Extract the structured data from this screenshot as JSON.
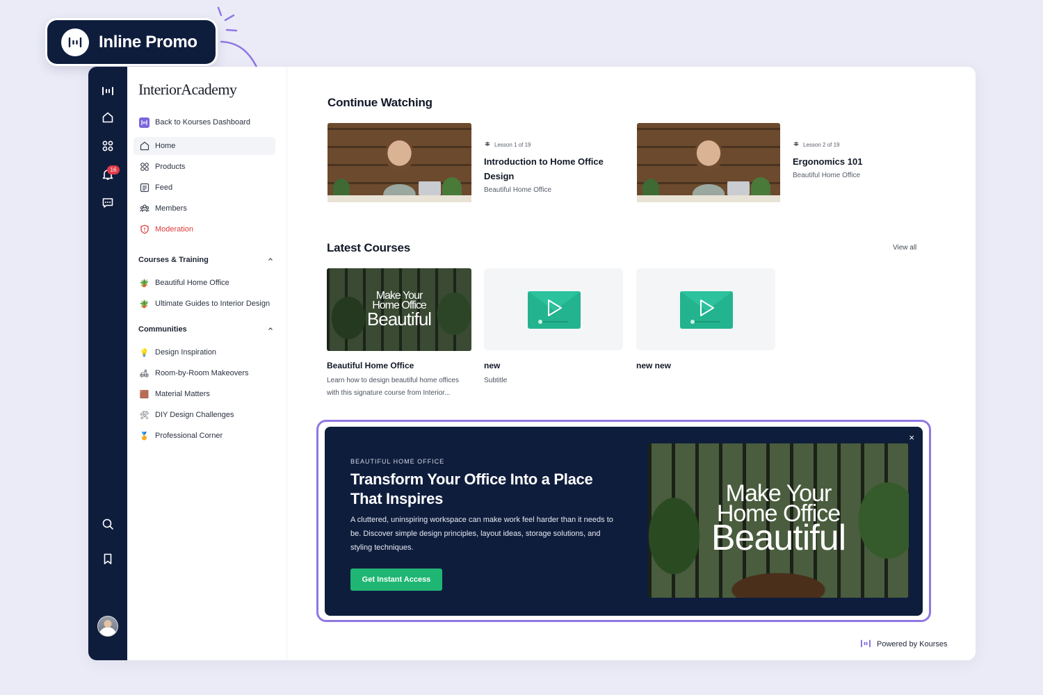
{
  "callout": {
    "label": "Inline Promo"
  },
  "rail": {
    "notification_count": "16"
  },
  "sidebar": {
    "brand": "InteriorAcademy",
    "back_link": "Back to Kourses Dashboard",
    "nav": [
      {
        "label": "Home",
        "icon": "home-icon"
      },
      {
        "label": "Products",
        "icon": "grid-icon"
      },
      {
        "label": "Feed",
        "icon": "feed-icon"
      },
      {
        "label": "Members",
        "icon": "members-icon"
      },
      {
        "label": "Moderation",
        "icon": "shield-icon"
      }
    ],
    "courses_heading": "Courses & Training",
    "courses": [
      {
        "label": "Beautiful Home Office",
        "emoji": "🪴"
      },
      {
        "label": "Ultimate Guides to Interior Design",
        "emoji": "🪴"
      }
    ],
    "communities_heading": "Communities",
    "communities": [
      {
        "label": "Design Inspiration",
        "emoji": "💡"
      },
      {
        "label": "Room-by-Room Makeovers",
        "emoji": "🛋"
      },
      {
        "label": "Material Matters",
        "emoji": "🟫"
      },
      {
        "label": "DIY Design Challenges",
        "emoji": "🛠"
      },
      {
        "label": "Professional Corner",
        "emoji": "🏅"
      }
    ]
  },
  "main": {
    "continue_heading": "Continue Watching",
    "continue": [
      {
        "lesson": "Lesson 1 of 19",
        "title": "Introduction to Home Office Design",
        "course": "Beautiful Home Office"
      },
      {
        "lesson": "Lesson 2 of 19",
        "title": "Ergonomics 101",
        "course": "Beautiful Home Office"
      }
    ],
    "latest_heading": "Latest Courses",
    "view_all": "View all",
    "thumb_text": {
      "line1": "Make Your",
      "line2": "Home Office",
      "line3": "Beautiful"
    },
    "courses": [
      {
        "title": "Beautiful Home Office",
        "desc": "Learn how to design beautiful home offices with this signature course from Interior..."
      },
      {
        "title": "new",
        "desc": "Subtitle"
      },
      {
        "title": "new new",
        "desc": ""
      }
    ]
  },
  "promo": {
    "eyebrow": "BEAUTIFUL HOME OFFICE",
    "title": "Transform Your Office Into a Place That Inspires",
    "body": "A cluttered, uninspiring workspace can make work feel harder than it needs to be. Discover simple design principles, layout ideas, storage solutions, and styling techniques.",
    "cta": "Get Instant Access",
    "close": "×"
  },
  "footer": {
    "powered_by": "Powered by Kourses"
  },
  "colors": {
    "navy": "#0f1d3d",
    "accent": "#8f77e3",
    "cta": "#1fb673",
    "play": "#23b38f",
    "danger": "#de3b3b"
  }
}
